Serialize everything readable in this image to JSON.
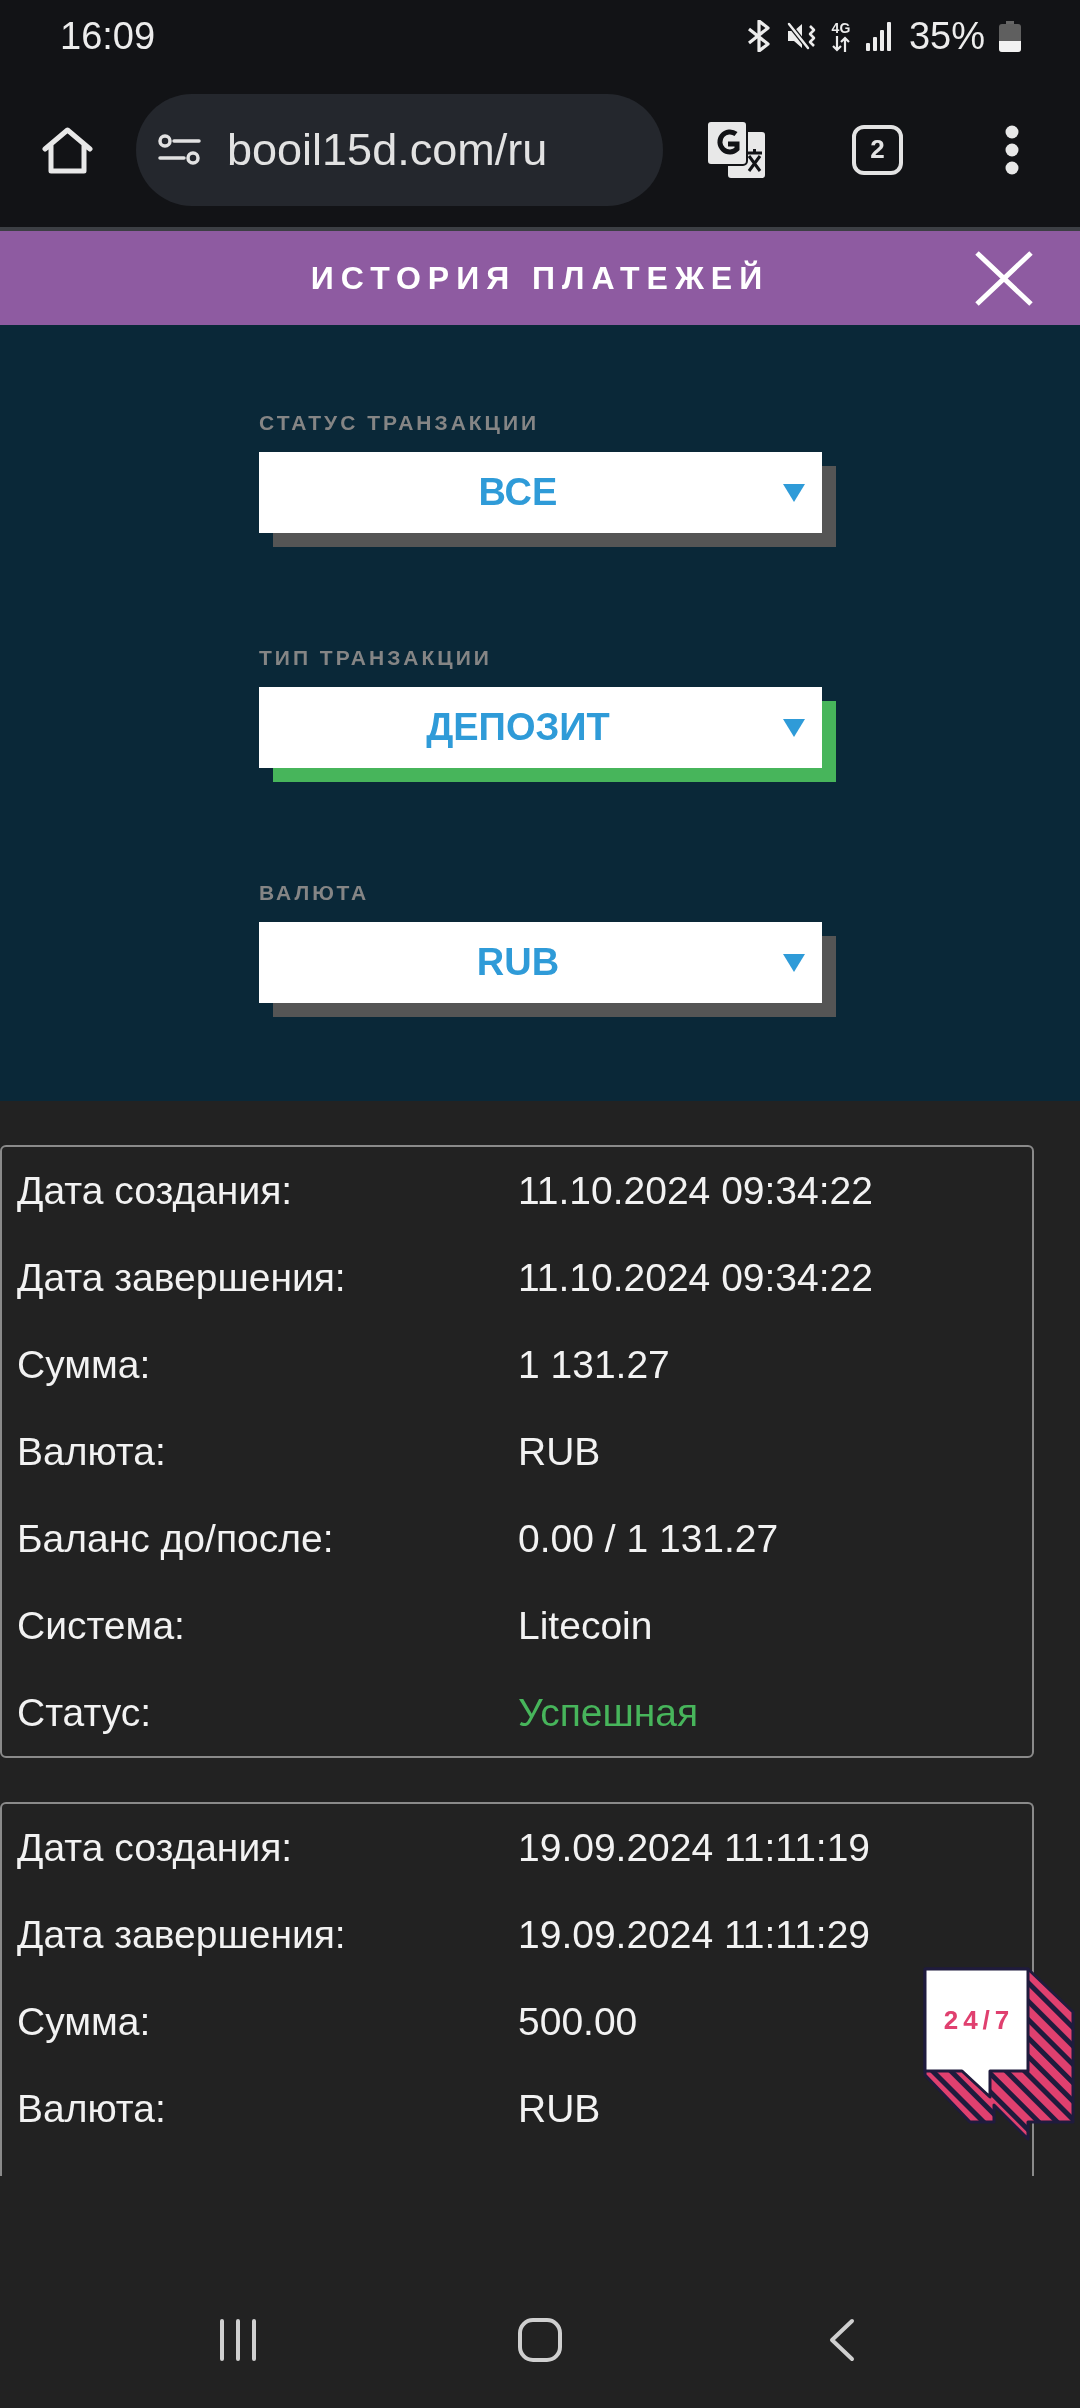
{
  "status_bar": {
    "time": "16:09",
    "network": "4G",
    "battery": "35%"
  },
  "browser": {
    "url": "booil15d.com/ru",
    "tab_count": "2"
  },
  "header": {
    "title": "ИСТОРИЯ ПЛАТЕЖЕЙ"
  },
  "filters": [
    {
      "label": "СТАТУС ТРАНЗАКЦИИ",
      "value": "ВСЕ",
      "active": false
    },
    {
      "label": "ТИП ТРАНЗАКЦИИ",
      "value": "ДЕПОЗИТ",
      "active": true
    },
    {
      "label": "ВАЛЮТА",
      "value": "RUB",
      "active": false
    }
  ],
  "transactions": [
    {
      "fields": [
        {
          "label": "Дата создания:",
          "value": "11.10.2024 09:34:22"
        },
        {
          "label": "Дата завершения:",
          "value": "11.10.2024 09:34:22"
        },
        {
          "label": "Сумма:",
          "value": "1 131.27"
        },
        {
          "label": "Валюта:",
          "value": "RUB"
        },
        {
          "label": "Баланс до/после:",
          "value": "0.00 / 1 131.27"
        },
        {
          "label": "Система:",
          "value": "Litecoin"
        },
        {
          "label": "Статус:",
          "value": "Успешная",
          "color": "#47b55b"
        }
      ]
    },
    {
      "fields": [
        {
          "label": "Дата создания:",
          "value": "19.09.2024 11:11:19"
        },
        {
          "label": "Дата завершения:",
          "value": "19.09.2024 11:11:29"
        },
        {
          "label": "Сумма:",
          "value": "500.00"
        },
        {
          "label": "Валюта:",
          "value": "RUB"
        }
      ]
    }
  ],
  "chat_widget": {
    "label": "24/7"
  }
}
